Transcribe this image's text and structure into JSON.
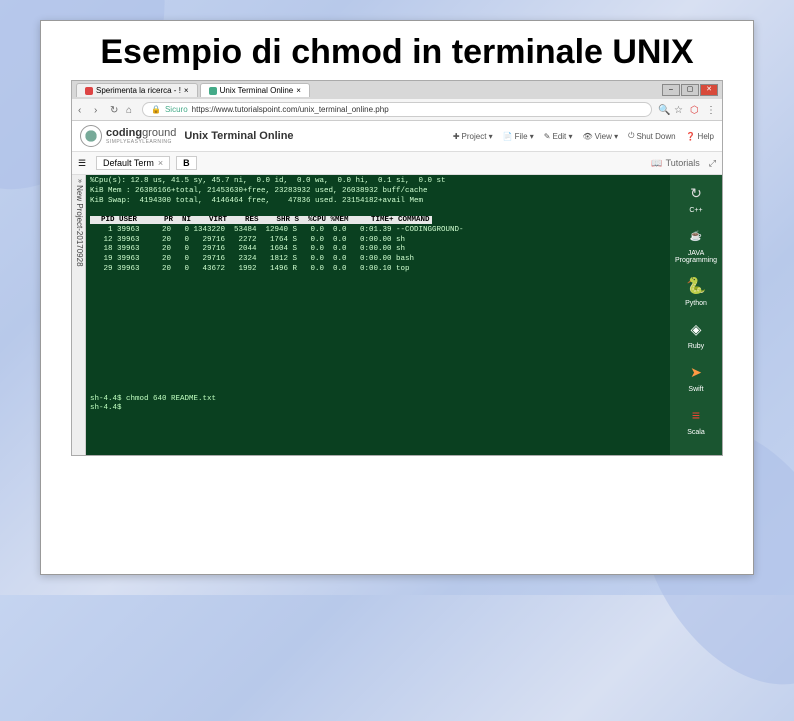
{
  "slide": {
    "title": "Esempio di chmod in terminale UNIX"
  },
  "browser": {
    "tabs": [
      {
        "label": "Sperimenta la ricerca - !",
        "favicon_color": "#d44"
      },
      {
        "label": "Unix Terminal Online",
        "favicon_color": "#4a8"
      }
    ],
    "url_prefix": "Sicuro",
    "url": "https://www.tutorialspoint.com/unix_terminal_online.php",
    "window_controls": [
      "–",
      "▢",
      "✕"
    ]
  },
  "site": {
    "logo_text_bold": "coding",
    "logo_text_rest": "ground",
    "logo_sub": "SIMPLYEASYLEARNING",
    "page_title": "Unix Terminal Online",
    "toolbar": [
      {
        "icon": "✚",
        "label": "Project ▾"
      },
      {
        "icon": "📄",
        "label": "File ▾"
      },
      {
        "icon": "✎",
        "label": "Edit ▾"
      },
      {
        "icon": "👁",
        "label": "View ▾"
      },
      {
        "icon": "⏻",
        "label": "Shut Down"
      },
      {
        "icon": "❓",
        "label": "Help"
      }
    ]
  },
  "ide": {
    "default_term": "Default Term",
    "close_x": "×",
    "bold_btn": "B",
    "tutorials": "Tutorials",
    "tutorials_icon": "📖",
    "expand_icon": "⤢",
    "left_sidebar": "New Project-20170928"
  },
  "terminal": {
    "sys_line1": "%Cpu(s): 12.8 us, 41.5 sy, 45.7 ni,  0.0 id,  0.0 wa,  0.0 hi,  0.1 si,  0.0 st",
    "sys_line2": "KiB Mem : 26386166+total, 21453630+free, 23283932 used, 26038932 buff/cache",
    "sys_line3": "KiB Swap:  4194300 total,  4146464 free,    47836 used. 23154182+avail Mem",
    "header": "  PID USER      PR  NI    VIRT    RES    SHR S  %CPU %MEM     TIME+ COMMAND",
    "rows": [
      "    1 39963     20   0 1343220  53484  12940 S   0.0  0.0   0:01.39 --CODINGGROUND-",
      "   12 39963     20   0   29716   2272   1764 S   0.0  0.0   0:00.00 sh",
      "   18 39963     20   0   29716   2044   1604 S   0.0  0.0   0:00.00 sh",
      "   19 39963     20   0   29716   2324   1812 S   0.0  0.0   0:00.00 bash",
      "   29 39963     20   0   43672   1992   1496 R   0.0  0.0   0:00.10 top"
    ],
    "prompt1": "sh-4.4$ chmod 640 README.txt",
    "prompt2": "sh-4.4$"
  },
  "languages": [
    {
      "icon": "↻",
      "label": "C++",
      "color": "#ddd"
    },
    {
      "icon": "☕",
      "label": "JAVA Programming",
      "color": "#e0d0b0"
    },
    {
      "icon": "🐍",
      "label": "Python",
      "color": "#ffdd55"
    },
    {
      "icon": "◈",
      "label": "Ruby",
      "color": "#ff6666"
    },
    {
      "icon": "➤",
      "label": "Swift",
      "color": "#ff9944"
    },
    {
      "icon": "≡",
      "label": "Scala",
      "color": "#ee4433"
    }
  ]
}
